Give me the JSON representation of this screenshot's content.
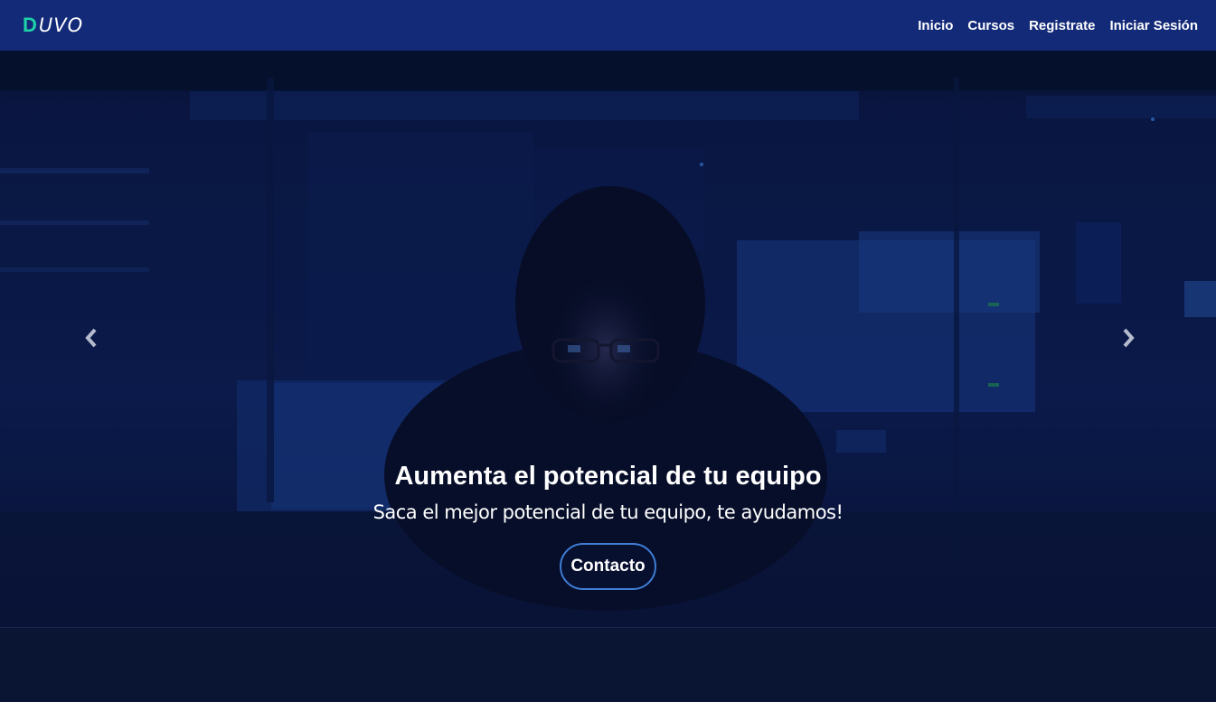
{
  "brand": {
    "logo_mark": "D",
    "logo_rest": "UVO"
  },
  "nav": {
    "items": [
      {
        "label": "Inicio"
      },
      {
        "label": "Cursos"
      },
      {
        "label": "Registrate"
      },
      {
        "label": "Iniciar Sesión"
      }
    ]
  },
  "hero": {
    "title": "Aumenta el potencial de tu equipo",
    "subtitle": "Saca el mejor potencial de tu equipo, te ayudamos!",
    "cta_label": "Contacto",
    "prev_icon": "chevron-left-icon",
    "next_icon": "chevron-right-icon"
  },
  "colors": {
    "navbar": "#132a78",
    "accent_logo": "#1fd1a8",
    "button_border": "#3f7dd6",
    "page_bg": "#0a1433"
  }
}
